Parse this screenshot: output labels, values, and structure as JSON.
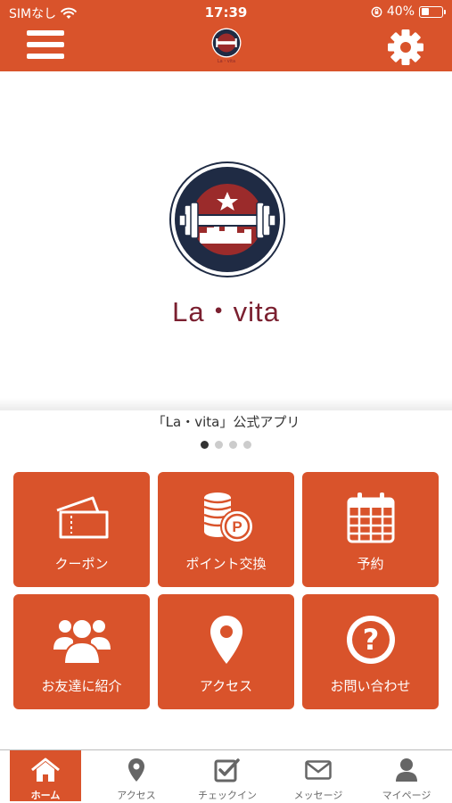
{
  "status_bar": {
    "carrier": "SIMなし",
    "time": "17:39",
    "battery_percent": "40%",
    "battery_level": 0.4
  },
  "header": {
    "logo_caption": "La・vita",
    "bar_color": "#d9532b"
  },
  "hero": {
    "brand_name": "La・vita"
  },
  "caption": "「La・vita」公式アプリ",
  "carousel": {
    "page_count": 4,
    "active_index": 0
  },
  "tiles": [
    {
      "label": "クーポン",
      "icon": "ticket-icon"
    },
    {
      "label": "ポイント交換",
      "icon": "coins-point-icon"
    },
    {
      "label": "予約",
      "icon": "calendar-icon"
    },
    {
      "label": "お友達に紹介",
      "icon": "users-icon"
    },
    {
      "label": "アクセス",
      "icon": "map-pin-icon"
    },
    {
      "label": "お問い合わせ",
      "icon": "question-circle-icon"
    }
  ],
  "bottom_nav": [
    {
      "label": "ホーム",
      "icon": "home-icon",
      "active": true
    },
    {
      "label": "アクセス",
      "icon": "map-pin-icon",
      "active": false
    },
    {
      "label": "チェックイン",
      "icon": "checkbox-icon",
      "active": false
    },
    {
      "label": "メッセージ",
      "icon": "envelope-icon",
      "active": false
    },
    {
      "label": "マイページ",
      "icon": "person-icon",
      "active": false
    }
  ],
  "colors": {
    "accent": "#d9532b",
    "brand_text": "#7b2030",
    "logo_navy": "#1f2b44",
    "logo_red": "#9b2b2b"
  }
}
